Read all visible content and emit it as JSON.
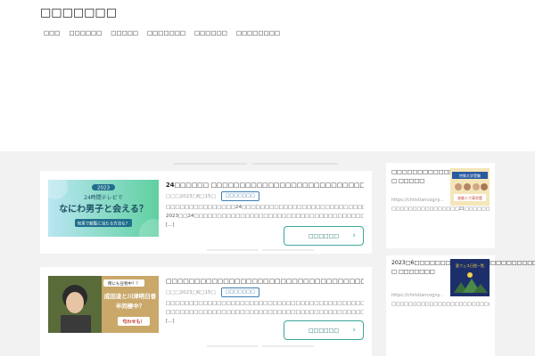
{
  "header": {
    "site_title": "□□□□□□□",
    "nav": [
      "□□□",
      "□□□□□□",
      "□□□□□",
      "□□□□□□□",
      "□□□□□□",
      "□□□□□□□□"
    ]
  },
  "posts": [
    {
      "title": "24□□□□□□ □□□□□□□□□□□□□□□□□□□□□□□□□□□□□□□□□□□□□",
      "date": "□□□2023□6□15□",
      "category": "□□□□□□□",
      "excerpt": "□□□□□□□□□□□□□□□24□□□□□□□□□□□□□□□□□□□□□□□□□□□□□□□□□□ 2023□□24□□□□□□□□□□□□□□□□□□□□□□□□□□□□□□□□□□□□□□□□□□□□□□□□□24□□□□□□ [...]",
      "more_label": "□□□□□□",
      "thumb": {
        "badge": "2023",
        "line1": "24時間テレビで",
        "line2": "なにわ男子と会える？",
        "line3": "知恵で観覧に当たる方法も？"
      }
    },
    {
      "title": "□□□□□□□□□□□□□□□□□□□□□□□□□□□□□□□□□□□□□□□□□□",
      "date": "□□□2023□6□15□",
      "category": "□□□□□□□",
      "excerpt": "□□□□□□□□□□□□□□□□□□□□□□□□□□□□□□□□□□□□□□□□□□□□□□□□□□□□□□□□□□□□ □□□□□□□□□□□□□□□□□□□□□□□□□□□□□□□□□□□□□□□□□□□□ [...]",
      "more_label": "□□□□□□",
      "thumb": {
        "tag": "俺にも豆物中？？",
        "name": "成田凌と川津明日香",
        "line2": "半同棲中？",
        "cta": "匂わせも！"
      }
    }
  ],
  "sidebar": [
    {
      "title": "□□□□□□□□□□□□□21□□□□ □ □□□□□",
      "url": "https://christiancogny...",
      "desc": "□□□□□□□□□□□□□□□□21□□□□□□□□□□□□□□□□□□□□□□□□□□□□□□□□□□□□□□□□□□□□□...",
      "thumb": {
        "top": "特殊大学受験",
        "bottom": "芸能人で高学歴"
      }
    },
    {
      "title": "2023□6□□□□□□□□6□□□□□□□□□□□□□□□ □ □□□□□□□",
      "url": "https://christiancogny...",
      "desc": "□□□□□□□□□□□□□□□□□□□□□□□□□□□□□□□□□□□□□□□□□□□□□□□□□□□□□□□□...",
      "thumb": {
        "top": "夏フェス日程一覧"
      }
    }
  ],
  "colors": {
    "accent": "#3aa79a",
    "category": "#3b7fb5",
    "background": "#f2f2f2"
  }
}
